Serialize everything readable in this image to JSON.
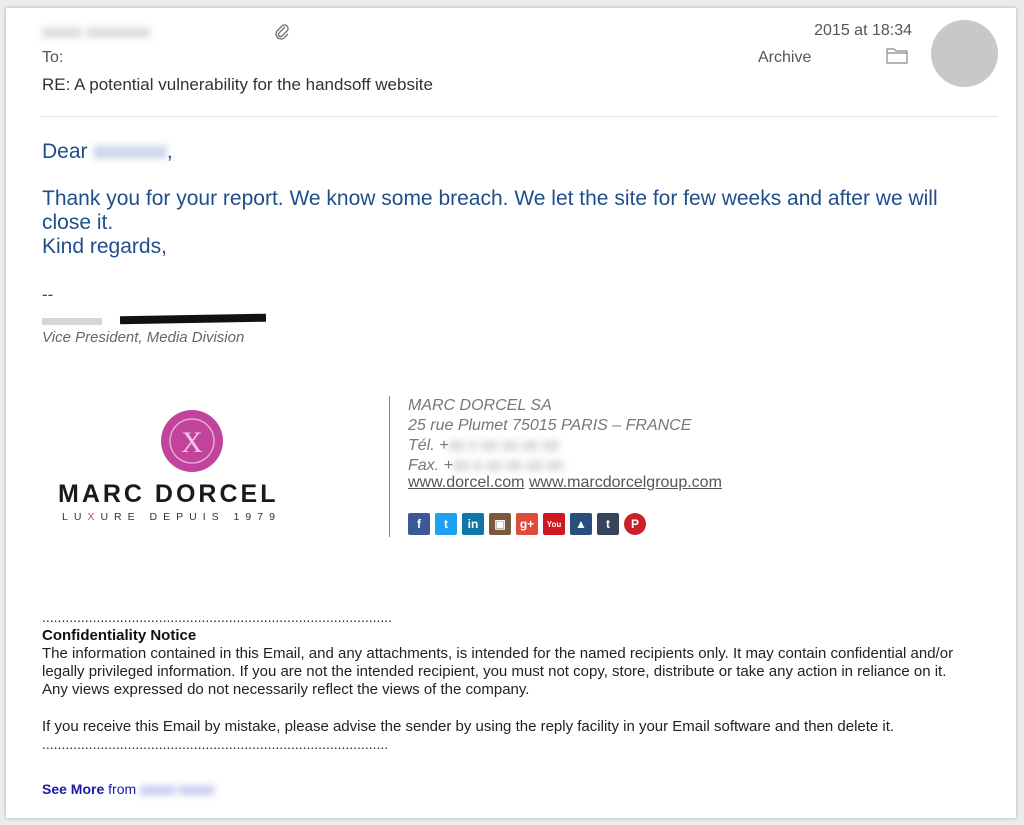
{
  "header": {
    "sender_redacted": "xxxxx xxxxxxxx",
    "date": "2015 at 18:34",
    "to_label": "To:",
    "archive_label": "Archive",
    "subject": "RE: A potential vulnerability for the handsoff website",
    "icons": {
      "attachment": "paperclip-icon",
      "folder": "folder-icon",
      "avatar": "avatar"
    }
  },
  "body": {
    "greeting": "Dear",
    "greeting_redacted": "xxxxxxx",
    "greeting_end": ",",
    "paragraph": "Thank you for your report. We know some breach. We let the site for few weeks and after we will close it.",
    "closing": "Kind regards,",
    "sig_sep": "--",
    "sig_title": "Vice President, Media Division"
  },
  "signature": {
    "logo": {
      "name": "MARC DORCEL",
      "tagline_1": "LU",
      "tagline_x": "X",
      "tagline_2": "URE  DEPUIS  1979",
      "seal_letter": "X"
    },
    "company": "MARC DORCEL SA",
    "address": "25 rue Plumet 75015 PARIS – FRANCE",
    "tel_label": "Tél. +",
    "fax_label": "Fax. +",
    "link1": "www.dorcel.com",
    "link2": "www.marcdorcelgroup.com",
    "socials": [
      {
        "name": "facebook-icon",
        "glyph": "f",
        "color": "#3b5998"
      },
      {
        "name": "twitter-icon",
        "glyph": "t",
        "color": "#1da1f2"
      },
      {
        "name": "linkedin-icon",
        "glyph": "in",
        "color": "#0e76a8"
      },
      {
        "name": "instagram-icon",
        "glyph": "▣",
        "color": "#7a5a3e"
      },
      {
        "name": "googleplus-icon",
        "glyph": "g+",
        "color": "#dd4b39"
      },
      {
        "name": "youtube-icon",
        "glyph": "You",
        "color": "#cc181e"
      },
      {
        "name": "dorcel-app-icon",
        "glyph": "▲",
        "color": "#2a4f7c"
      },
      {
        "name": "tumblr-icon",
        "glyph": "t",
        "color": "#35465c"
      },
      {
        "name": "pinterest-icon",
        "glyph": "P",
        "color": "#cb2027"
      }
    ],
    "colors": {
      "seal": "#c2439c",
      "logo_text": "#1a1a1a",
      "tagline_x": "#c2439c"
    }
  },
  "confidentiality": {
    "dots": "..........................................................................................",
    "title": "Confidentiality Notice",
    "p1": "The information contained in this Email, and any attachments, is intended for the named recipients only. It may contain confidential and/or legally privileged information. If you are not the intended recipient, you must not copy, store, distribute or take any action in reliance on it. Any views expressed do not necessarily reflect the views of the company.",
    "p2": "If you receive this Email by mistake, please advise the sender by using the reply facility in your Email software and then delete it.",
    "dots2": "........................................................................................."
  },
  "footer": {
    "see_more": "See More",
    "from": "from"
  }
}
